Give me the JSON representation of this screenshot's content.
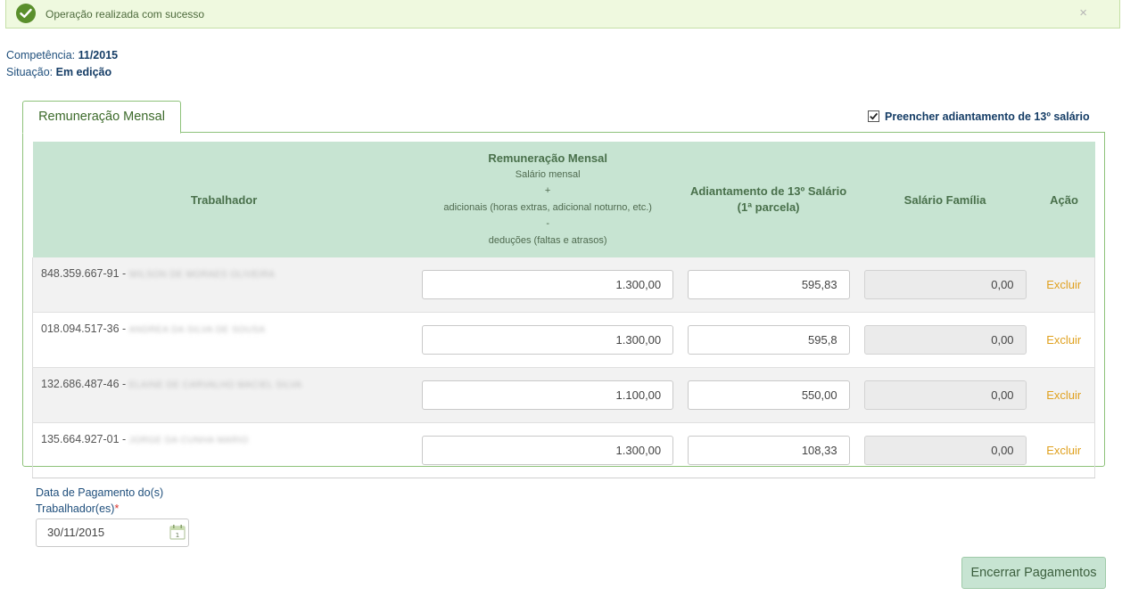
{
  "alert": {
    "message": "Operação realizada com sucesso",
    "close_glyph": "×"
  },
  "info": {
    "competencia_label": "Competência:",
    "competencia_value": "11/2015",
    "situacao_label": "Situação:",
    "situacao_value": "Em edição"
  },
  "tab": {
    "label": "Remuneração Mensal"
  },
  "checkbox": {
    "label": "Preencher adiantamento de 13º salário",
    "checked": true
  },
  "table": {
    "headers": {
      "trabalhador": "Trabalhador",
      "remuneracao_title": "Remuneração Mensal",
      "remuneracao_sub1": "Salário mensal",
      "remuneracao_sub2": "+",
      "remuneracao_sub3": "adicionais (horas extras, adicional noturno, etc.)",
      "remuneracao_sub4": "-",
      "remuneracao_sub5": "deduções (faltas e atrasos)",
      "adiantamento_1": "Adiantamento de 13º Salário",
      "adiantamento_2": "(1ª parcela)",
      "salario_familia": "Salário Família",
      "acao": "Ação"
    },
    "rows": [
      {
        "cpf": "848.359.667-91 -",
        "name": "WILSON DE MORAES OLIVEIRA",
        "remuneracao": "1.300,00",
        "adiantamento": "595,83",
        "salario_familia": "0,00",
        "action": "Excluir"
      },
      {
        "cpf": "018.094.517-36 -",
        "name": "ANDREA DA SILVA DE SOUSA",
        "remuneracao": "1.300,00",
        "adiantamento": "595,8",
        "salario_familia": "0,00",
        "action": "Excluir"
      },
      {
        "cpf": "132.686.487-46 -",
        "name": "ELAINE DE CARVALHO MACIEL SILVA",
        "remuneracao": "1.100,00",
        "adiantamento": "550,00",
        "salario_familia": "0,00",
        "action": "Excluir"
      },
      {
        "cpf": "135.664.927-01 -",
        "name": "JORGE DA CUNHA MARIO",
        "remuneracao": "1.300,00",
        "adiantamento": "108,33",
        "salario_familia": "0,00",
        "action": "Excluir"
      }
    ]
  },
  "payment_date": {
    "label_line1": "Data de Pagamento do(s)",
    "label_line2": "Trabalhador(es)",
    "required_mark": "*",
    "value": "30/11/2015",
    "calendar_day": "1"
  },
  "buttons": {
    "encerrar": "Encerrar Pagamentos"
  },
  "colors": {
    "accent_green": "#5a8f2c",
    "header_green": "#c7e4d2",
    "link_orange": "#e0a11f",
    "label_blue": "#1f4f7c"
  },
  "icons": {
    "success": "check-circle-icon",
    "close": "close-icon",
    "checkbox": "checkmark-icon",
    "calendar": "calendar-icon"
  }
}
